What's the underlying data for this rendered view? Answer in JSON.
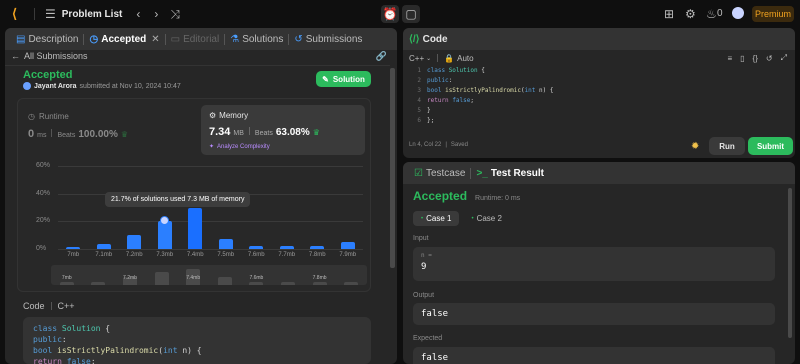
{
  "topbar": {
    "title": "Problem List",
    "notes_count": "0",
    "premium_label": "Premium"
  },
  "left_tabs": [
    "Description",
    "Accepted",
    "Editorial",
    "Solutions",
    "Submissions"
  ],
  "submission": {
    "back_label": "All Submissions",
    "status": "Accepted",
    "user": "Jayant Arora",
    "submitted_text": "submitted at Nov 10, 2024 10:47",
    "solution_button": "Solution"
  },
  "runtime": {
    "label": "Runtime",
    "value": "0",
    "unit": "ms",
    "beats_label": "Beats",
    "beats_value": "100.00%"
  },
  "memory": {
    "label": "Memory",
    "value": "7.34",
    "unit": "MB",
    "beats_label": "Beats",
    "beats_value": "63.08%",
    "analyze_label": "Analyze Complexity"
  },
  "chart_data": {
    "type": "bar",
    "categories": [
      "7mb",
      "7.1mb",
      "7.2mb",
      "7.3mb",
      "7.4mb",
      "7.5mb",
      "7.6mb",
      "7.7mb",
      "7.8mb",
      "7.9mb"
    ],
    "values": [
      1.5,
      3.5,
      10.0,
      20.5,
      29.5,
      7.0,
      2.0,
      2.0,
      2.0,
      5.0
    ],
    "highlight_index": 4,
    "yticks": [
      "0%",
      "20%",
      "40%",
      "60%"
    ],
    "ylim": [
      0,
      62
    ],
    "tooltip": "21.7% of solutions used 7.3 MB of memory",
    "overview_labels": [
      "7mb",
      "7.2mb",
      "7.4mb",
      "7.6mb",
      "7.8mb"
    ],
    "overview_values": [
      2,
      2,
      5,
      8,
      10,
      5,
      2,
      2,
      2,
      2
    ]
  },
  "left_code": {
    "header": "Code",
    "lang": "C++",
    "lines": [
      [
        "class Solution {"
      ],
      [
        "public:"
      ],
      [
        "    bool isStrictlyPalindromic(int n) {"
      ],
      [
        "        return false;"
      ]
    ]
  },
  "editor": {
    "title": "Code",
    "lang": "C++",
    "mode": "Auto",
    "line_numbers": [
      "1",
      "2",
      "3",
      "4",
      "5",
      "6"
    ],
    "status": "Ln 4, Col 22",
    "saved": "Saved",
    "run_label": "Run",
    "submit_label": "Submit"
  },
  "result": {
    "tab_testcase": "Testcase",
    "tab_result": "Test Result",
    "status": "Accepted",
    "runtime": "Runtime: 0 ms",
    "case1": "Case 1",
    "case2": "Case 2",
    "input_label": "Input",
    "input_var": "n =",
    "input_value": "9",
    "output_label": "Output",
    "output_value": "false",
    "expected_label": "Expected",
    "expected_value": "false"
  },
  "colors": {
    "accent_green": "#2cbb5d",
    "bar_blue": "#2b7fff",
    "premium": "#f0a21f"
  }
}
